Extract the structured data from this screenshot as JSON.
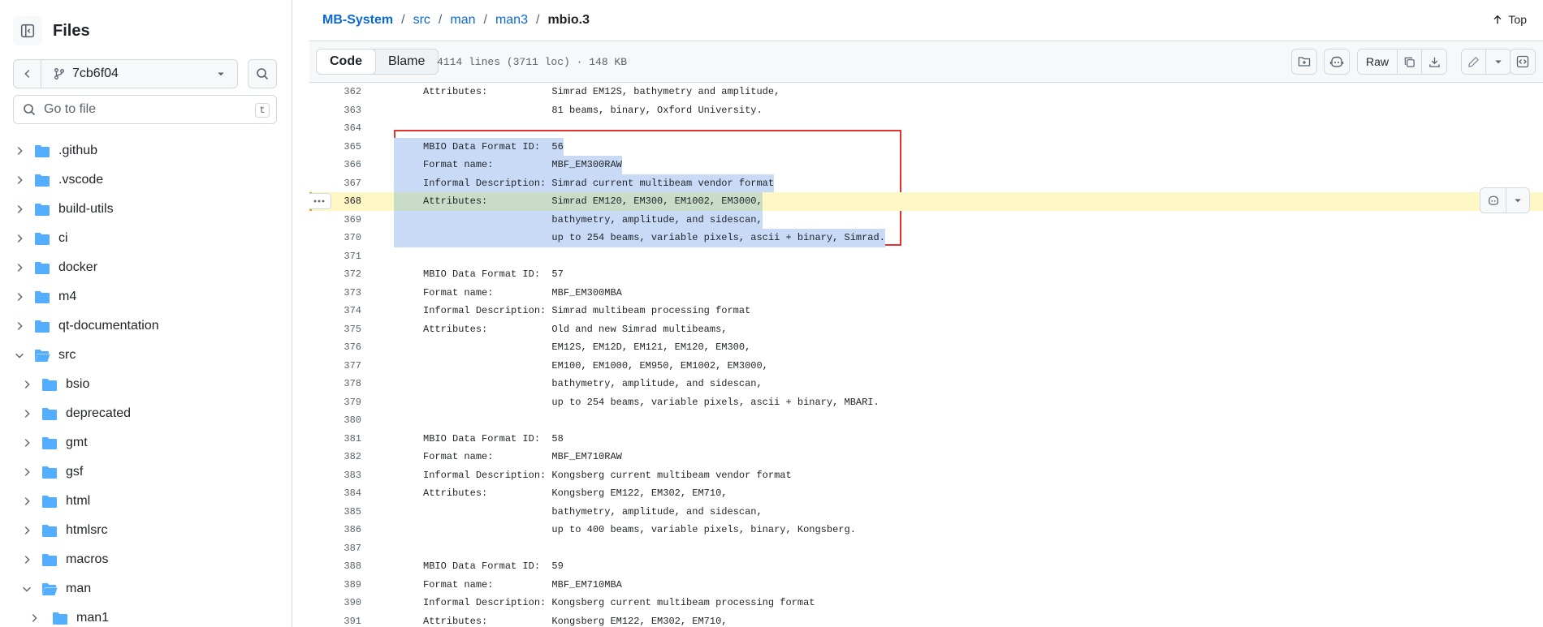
{
  "sidebar": {
    "title": "Files",
    "branch": "7cb6f04",
    "search_placeholder": "Go to file",
    "search_shortcut": "t",
    "tree": [
      {
        "label": ".github",
        "depth": 0,
        "expanded": false
      },
      {
        "label": ".vscode",
        "depth": 0,
        "expanded": false
      },
      {
        "label": "build-utils",
        "depth": 0,
        "expanded": false
      },
      {
        "label": "ci",
        "depth": 0,
        "expanded": false
      },
      {
        "label": "docker",
        "depth": 0,
        "expanded": false
      },
      {
        "label": "m4",
        "depth": 0,
        "expanded": false
      },
      {
        "label": "qt-documentation",
        "depth": 0,
        "expanded": false
      },
      {
        "label": "src",
        "depth": 0,
        "expanded": true
      },
      {
        "label": "bsio",
        "depth": 1,
        "expanded": false
      },
      {
        "label": "deprecated",
        "depth": 1,
        "expanded": false
      },
      {
        "label": "gmt",
        "depth": 1,
        "expanded": false
      },
      {
        "label": "gsf",
        "depth": 1,
        "expanded": false
      },
      {
        "label": "html",
        "depth": 1,
        "expanded": false
      },
      {
        "label": "htmlsrc",
        "depth": 1,
        "expanded": false
      },
      {
        "label": "macros",
        "depth": 1,
        "expanded": false
      },
      {
        "label": "man",
        "depth": 1,
        "expanded": true
      },
      {
        "label": "man1",
        "depth": 2,
        "expanded": false
      }
    ]
  },
  "breadcrumb": {
    "root": "MB-System",
    "parts": [
      "src",
      "man",
      "man3"
    ],
    "current": "mbio.3",
    "separator": "/"
  },
  "top_button": "Top",
  "toolbar": {
    "code_tab": "Code",
    "blame_tab": "Blame",
    "file_info": "4114 lines (3711 loc) · 148 KB",
    "raw_label": "Raw"
  },
  "code": {
    "current_line": 368,
    "selected_range": [
      365,
      370
    ],
    "lines": [
      {
        "n": 362,
        "text": "     Attributes:           Simrad EM12S, bathymetry and amplitude,"
      },
      {
        "n": 363,
        "text": "                           81 beams, binary, Oxford University."
      },
      {
        "n": 364,
        "text": ""
      },
      {
        "n": 365,
        "text": "     MBIO Data Format ID:  56"
      },
      {
        "n": 366,
        "text": "     Format name:          MBF_EM300RAW"
      },
      {
        "n": 367,
        "text": "     Informal Description: Simrad current multibeam vendor format"
      },
      {
        "n": 368,
        "text": "     Attributes:           Simrad EM120, EM300, EM1002, EM3000,"
      },
      {
        "n": 369,
        "text": "                           bathymetry, amplitude, and sidescan,"
      },
      {
        "n": 370,
        "text": "                           up to 254 beams, variable pixels, ascii + binary, Simrad."
      },
      {
        "n": 371,
        "text": ""
      },
      {
        "n": 372,
        "text": "     MBIO Data Format ID:  57"
      },
      {
        "n": 373,
        "text": "     Format name:          MBF_EM300MBA"
      },
      {
        "n": 374,
        "text": "     Informal Description: Simrad multibeam processing format"
      },
      {
        "n": 375,
        "text": "     Attributes:           Old and new Simrad multibeams,"
      },
      {
        "n": 376,
        "text": "                           EM12S, EM12D, EM121, EM120, EM300,"
      },
      {
        "n": 377,
        "text": "                           EM100, EM1000, EM950, EM1002, EM3000,"
      },
      {
        "n": 378,
        "text": "                           bathymetry, amplitude, and sidescan,"
      },
      {
        "n": 379,
        "text": "                           up to 254 beams, variable pixels, ascii + binary, MBARI."
      },
      {
        "n": 380,
        "text": ""
      },
      {
        "n": 381,
        "text": "     MBIO Data Format ID:  58"
      },
      {
        "n": 382,
        "text": "     Format name:          MBF_EM710RAW"
      },
      {
        "n": 383,
        "text": "     Informal Description: Kongsberg current multibeam vendor format"
      },
      {
        "n": 384,
        "text": "     Attributes:           Kongsberg EM122, EM302, EM710,"
      },
      {
        "n": 385,
        "text": "                           bathymetry, amplitude, and sidescan,"
      },
      {
        "n": 386,
        "text": "                           up to 400 beams, variable pixels, binary, Kongsberg."
      },
      {
        "n": 387,
        "text": ""
      },
      {
        "n": 388,
        "text": "     MBIO Data Format ID:  59"
      },
      {
        "n": 389,
        "text": "     Format name:          MBF_EM710MBA"
      },
      {
        "n": 390,
        "text": "     Informal Description: Kongsberg current multibeam processing format"
      },
      {
        "n": 391,
        "text": "     Attributes:           Kongsberg EM122, EM302, EM710,"
      }
    ]
  },
  "colors": {
    "accent": "#0969da",
    "folder": "#54aeff",
    "selection": "#c8daf5",
    "current_line": "#fff8c5",
    "highlight_box": "#e5322d"
  }
}
